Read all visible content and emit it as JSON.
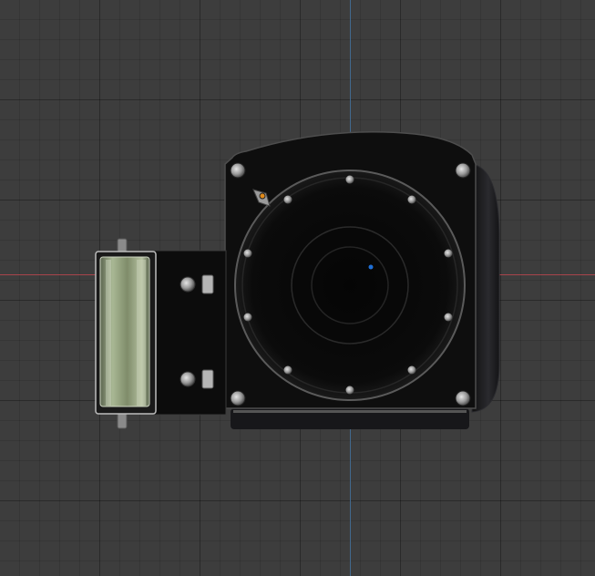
{
  "viewport": {
    "background": "#3d3d3d",
    "grid_minor_color": "rgba(0,0,0,0.12)",
    "grid_major_color": "rgba(0,0,0,0.22)",
    "x_axis_color": "#a8444b",
    "y_axis_color": "#42698e"
  },
  "model": {
    "body_color": "#0d0d0d",
    "edge_color": "#4a4a4a",
    "screw_color": "#9a9a9a",
    "bracket_glass_color": "#8c9a78",
    "center_marker_color": "#1f6fd6",
    "pivot_marker_color": "#e08a1a"
  }
}
